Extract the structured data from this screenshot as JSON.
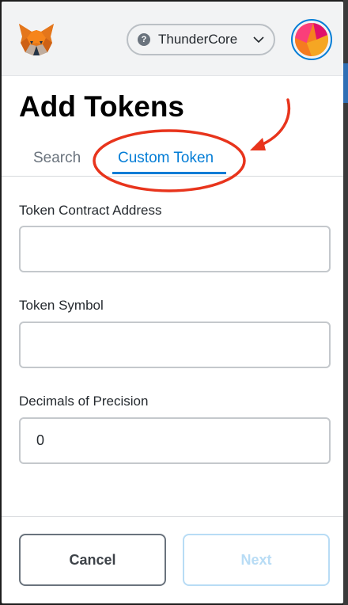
{
  "header": {
    "network": {
      "help_glyph": "?",
      "name": "ThunderCore"
    }
  },
  "page": {
    "title": "Add Tokens"
  },
  "tabs": [
    {
      "label": "Search",
      "active": false
    },
    {
      "label": "Custom Token",
      "active": true
    }
  ],
  "form": {
    "contract_address": {
      "label": "Token Contract Address",
      "value": ""
    },
    "symbol": {
      "label": "Token Symbol",
      "value": ""
    },
    "decimals": {
      "label": "Decimals of Precision",
      "value": "0"
    }
  },
  "footer": {
    "cancel_label": "Cancel",
    "next_label": "Next"
  },
  "colors": {
    "accent": "#037dd6",
    "annotation": "#e8341c",
    "disabled": "#b8dcf5"
  }
}
